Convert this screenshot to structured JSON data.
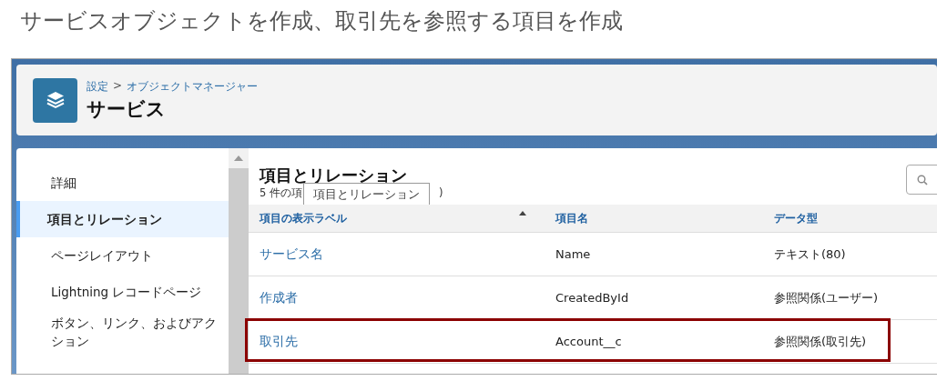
{
  "page_title": "サービスオブジェクトを作成、取引先を参照する項目を作成",
  "header": {
    "breadcrumb": [
      {
        "label": "設定"
      },
      {
        "label": "オブジェクトマネージャー"
      }
    ],
    "separator": ">",
    "title": "サービス"
  },
  "sidebar": {
    "items": [
      {
        "label": "詳細",
        "selected": false
      },
      {
        "label": "項目とリレーション",
        "selected": true
      },
      {
        "label": "ページレイアウト",
        "selected": false
      },
      {
        "label": "Lightning レコードページ",
        "selected": false
      },
      {
        "label": "ボタン、リンク、およびアクション",
        "selected": false
      }
    ]
  },
  "main": {
    "title": "項目とリレーション",
    "count_start": "5 件の項",
    "count_end": ")",
    "tooltip": "項目とリレーション",
    "table": {
      "columns": [
        {
          "label": "項目の表示ラベル",
          "sorted": true
        },
        {
          "label": "項目名",
          "sorted": false
        },
        {
          "label": "データ型",
          "sorted": false
        }
      ],
      "rows": [
        {
          "cells": [
            "サービス名",
            "Name",
            "テキスト(80)"
          ],
          "highlighted": false
        },
        {
          "cells": [
            "作成者",
            "CreatedById",
            "参照関係(ユーザー)"
          ],
          "highlighted": false
        },
        {
          "cells": [
            "取引先",
            "Account__c",
            "参照関係(取引先)"
          ],
          "highlighted": true
        }
      ]
    }
  }
}
